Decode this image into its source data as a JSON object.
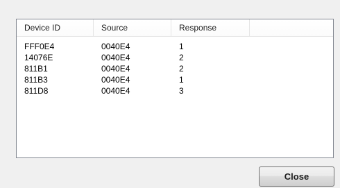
{
  "table": {
    "columns": [
      "Device ID",
      "Source",
      "Response"
    ],
    "rows": [
      [
        "FFF0E4",
        "0040E4",
        "1"
      ],
      [
        "14076E",
        "0040E4",
        "2"
      ],
      [
        "811B1",
        "0040E4",
        "2"
      ],
      [
        "811B3",
        "0040E4",
        "1"
      ],
      [
        "811D8",
        "0040E4",
        "3"
      ]
    ]
  },
  "buttons": {
    "close_label": "Close"
  }
}
